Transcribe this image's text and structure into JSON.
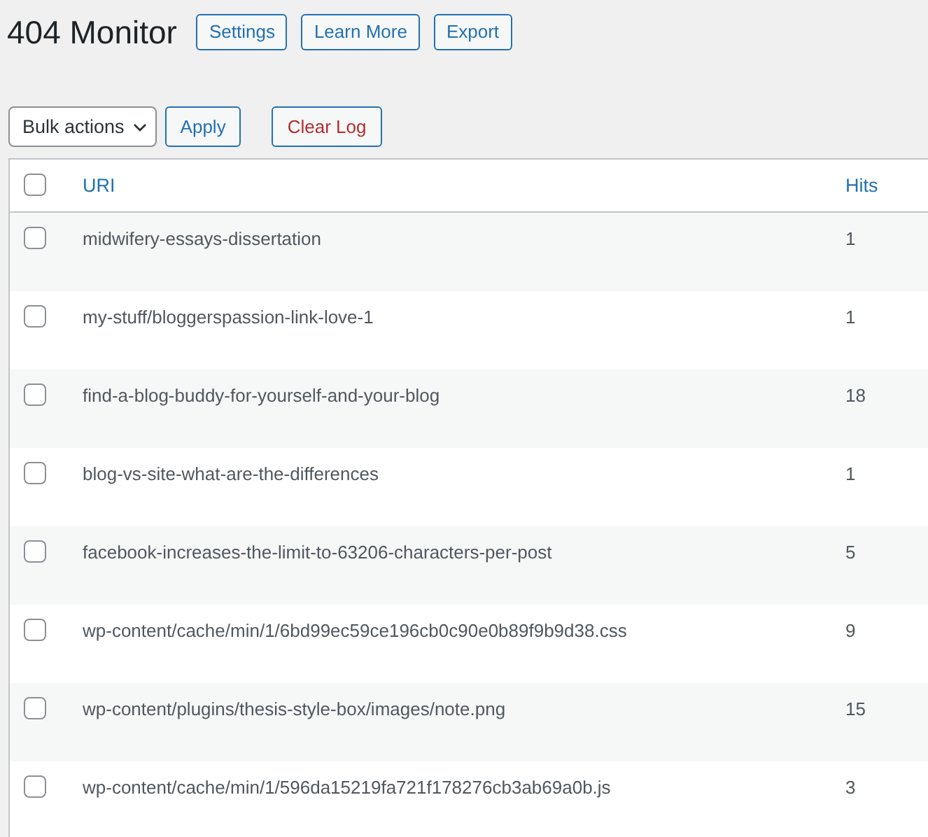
{
  "page_title": "404 Monitor",
  "header_buttons": [
    {
      "label": "Settings"
    },
    {
      "label": "Learn More"
    },
    {
      "label": "Export"
    }
  ],
  "bulk_actions": {
    "value": "Bulk actions"
  },
  "apply_button": {
    "label": "Apply"
  },
  "clear_log_button": {
    "label": "Clear Log"
  },
  "table": {
    "select_all_checked": false,
    "columns": [
      "URI",
      "Hits"
    ],
    "rows": [
      {
        "uri": "midwifery-essays-dissertation",
        "hits": "1",
        "checked": false
      },
      {
        "uri": "my-stuff/bloggerspassion-link-love-1",
        "hits": "1",
        "checked": false
      },
      {
        "uri": "find-a-blog-buddy-for-yourself-and-your-blog",
        "hits": "18",
        "checked": false
      },
      {
        "uri": "blog-vs-site-what-are-the-differences",
        "hits": "1",
        "checked": false
      },
      {
        "uri": "facebook-increases-the-limit-to-63206-characters-per-post",
        "hits": "5",
        "checked": false
      },
      {
        "uri": "wp-content/cache/min/1/6bd99ec59ce196cb0c90e0b89f9b9d38.css",
        "hits": "9",
        "checked": false
      },
      {
        "uri": "wp-content/plugins/thesis-style-box/images/note.png",
        "hits": "15",
        "checked": false
      },
      {
        "uri": "wp-content/cache/min/1/596da15219fa721f178276cb3ab69a0b.js",
        "hits": "3",
        "checked": false
      }
    ]
  }
}
